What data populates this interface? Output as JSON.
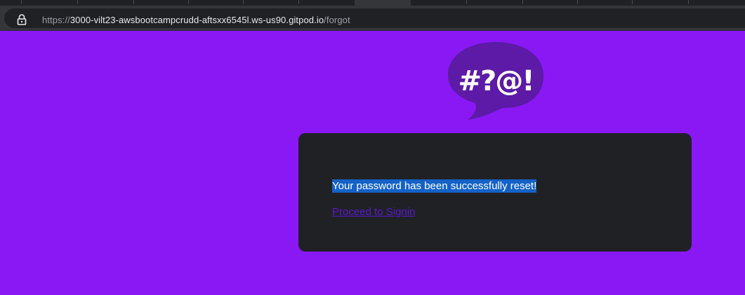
{
  "browser": {
    "url": {
      "scheme": "https://",
      "host": "3000-vilt23-awsbootcampcrudd-aftsxx6545l.ws-us90.gitpod.io",
      "path": "/forgot"
    }
  },
  "logo": {
    "icon": "speech-bubble-logo",
    "text": "#?@!",
    "color": "#5c1aa6"
  },
  "card": {
    "message": "Your password has been successfully reset!",
    "link_label": "Proceed to Signin"
  },
  "colors": {
    "page_background": "#8a18f4",
    "card_background": "#202124",
    "selection_highlight": "#1462c8",
    "link": "#5a1ad0"
  }
}
